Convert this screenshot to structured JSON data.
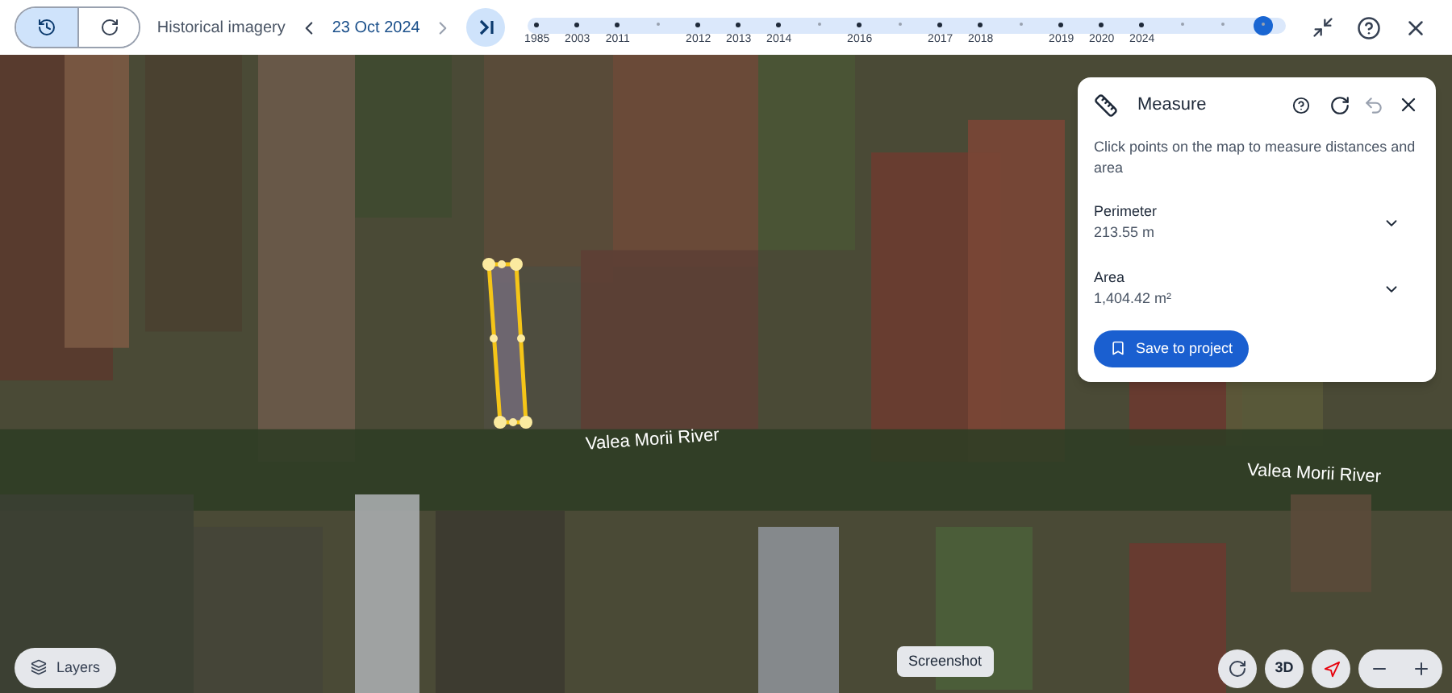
{
  "toolbar": {
    "mode_toggle": [
      {
        "selected": true
      },
      {
        "selected": false
      }
    ],
    "title": "Historical imagery",
    "date": "23 Oct 2024"
  },
  "timeline": {
    "level": 0.97,
    "ticks": [
      {
        "kind": "major",
        "label": "1985"
      },
      {
        "kind": "major",
        "label": "2003"
      },
      {
        "kind": "major",
        "label": "2011"
      },
      {
        "kind": "minor"
      },
      {
        "kind": "major",
        "label": "2012"
      },
      {
        "kind": "major",
        "label": "2013"
      },
      {
        "kind": "major",
        "label": "2014"
      },
      {
        "kind": "minor"
      },
      {
        "kind": "major",
        "label": "2016"
      },
      {
        "kind": "minor"
      },
      {
        "kind": "major",
        "label": "2017"
      },
      {
        "kind": "major",
        "label": "2018"
      },
      {
        "kind": "minor"
      },
      {
        "kind": "major",
        "label": "2019"
      },
      {
        "kind": "major",
        "label": "2020"
      },
      {
        "kind": "major",
        "label": "2024"
      },
      {
        "kind": "minor"
      },
      {
        "kind": "minor"
      },
      {
        "kind": "minor"
      }
    ]
  },
  "map": {
    "labels": [
      "Valea Morii River",
      "Valea Morii River"
    ]
  },
  "measure": {
    "title": "Measure",
    "instructions": "Click points on the map to measure distances and area",
    "rows": [
      {
        "label": "Perimeter",
        "value": "213.55 m"
      },
      {
        "label": "Area",
        "value": "1,404.42 m²"
      }
    ],
    "save_button": "Save to project"
  },
  "bottom": {
    "layers_button": "Layers",
    "screenshot_label": "Screenshot",
    "three_d_button": "3D"
  }
}
